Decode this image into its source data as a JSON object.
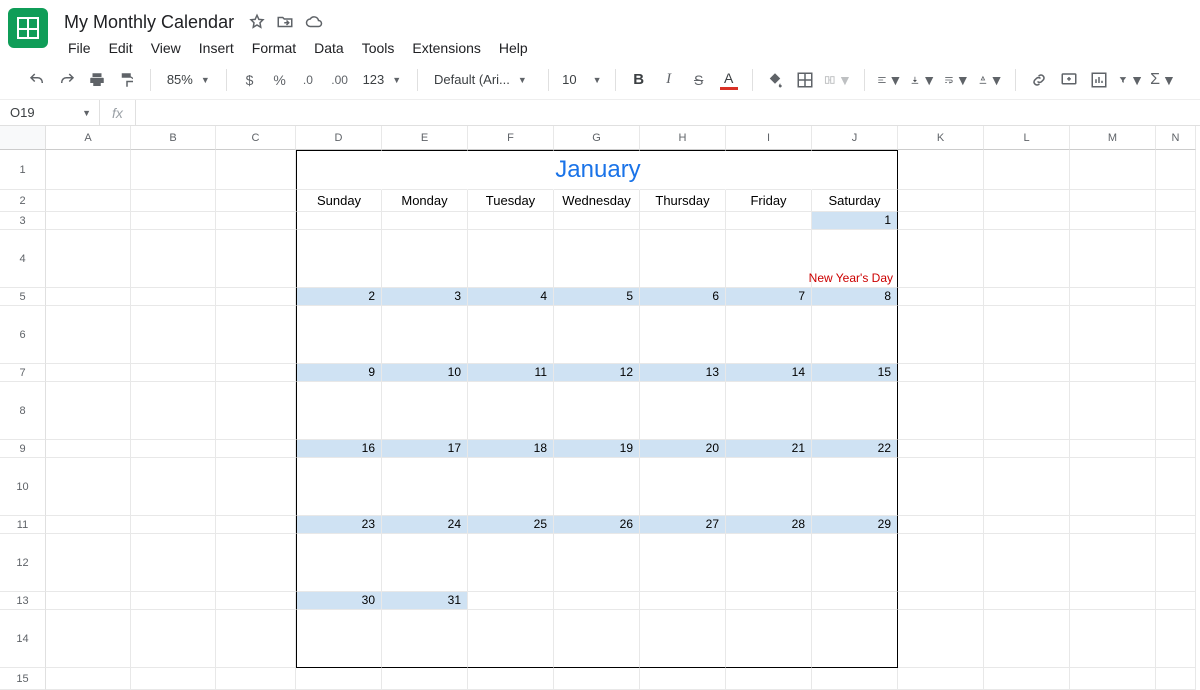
{
  "doc": {
    "title": "My Monthly Calendar"
  },
  "menus": [
    "File",
    "Edit",
    "View",
    "Insert",
    "Format",
    "Data",
    "Tools",
    "Extensions",
    "Help"
  ],
  "toolbar": {
    "zoom": "85%",
    "font": "Default (Ari...",
    "font_size": "10",
    "number_fmt": "123"
  },
  "namebox": "O19",
  "columns": [
    "A",
    "B",
    "C",
    "D",
    "E",
    "F",
    "G",
    "H",
    "I",
    "J",
    "K",
    "L",
    "M",
    "N"
  ],
  "row_numbers": [
    "1",
    "2",
    "3",
    "4",
    "5",
    "6",
    "7",
    "8",
    "9",
    "10",
    "11",
    "12",
    "13",
    "14",
    "15"
  ],
  "calendar": {
    "month": "January",
    "day_names": [
      "Sunday",
      "Monday",
      "Tuesday",
      "Wednesday",
      "Thursday",
      "Friday",
      "Saturday"
    ],
    "weeks": [
      {
        "nums": [
          "",
          "",
          "",
          "",
          "",
          "",
          "1"
        ],
        "events": [
          "",
          "",
          "",
          "",
          "",
          "",
          "New Year's Day"
        ]
      },
      {
        "nums": [
          "2",
          "3",
          "4",
          "5",
          "6",
          "7",
          "8"
        ],
        "events": [
          "",
          "",
          "",
          "",
          "",
          "",
          ""
        ]
      },
      {
        "nums": [
          "9",
          "10",
          "11",
          "12",
          "13",
          "14",
          "15"
        ],
        "events": [
          "",
          "",
          "",
          "",
          "",
          "",
          ""
        ]
      },
      {
        "nums": [
          "16",
          "17",
          "18",
          "19",
          "20",
          "21",
          "22"
        ],
        "events": [
          "",
          "",
          "",
          "",
          "",
          "",
          ""
        ]
      },
      {
        "nums": [
          "23",
          "24",
          "25",
          "26",
          "27",
          "28",
          "29"
        ],
        "events": [
          "",
          "",
          "",
          "",
          "",
          "",
          ""
        ]
      },
      {
        "nums": [
          "30",
          "31",
          "",
          "",
          "",
          "",
          ""
        ],
        "events": [
          "",
          "",
          "",
          "",
          "",
          "",
          ""
        ]
      }
    ]
  }
}
